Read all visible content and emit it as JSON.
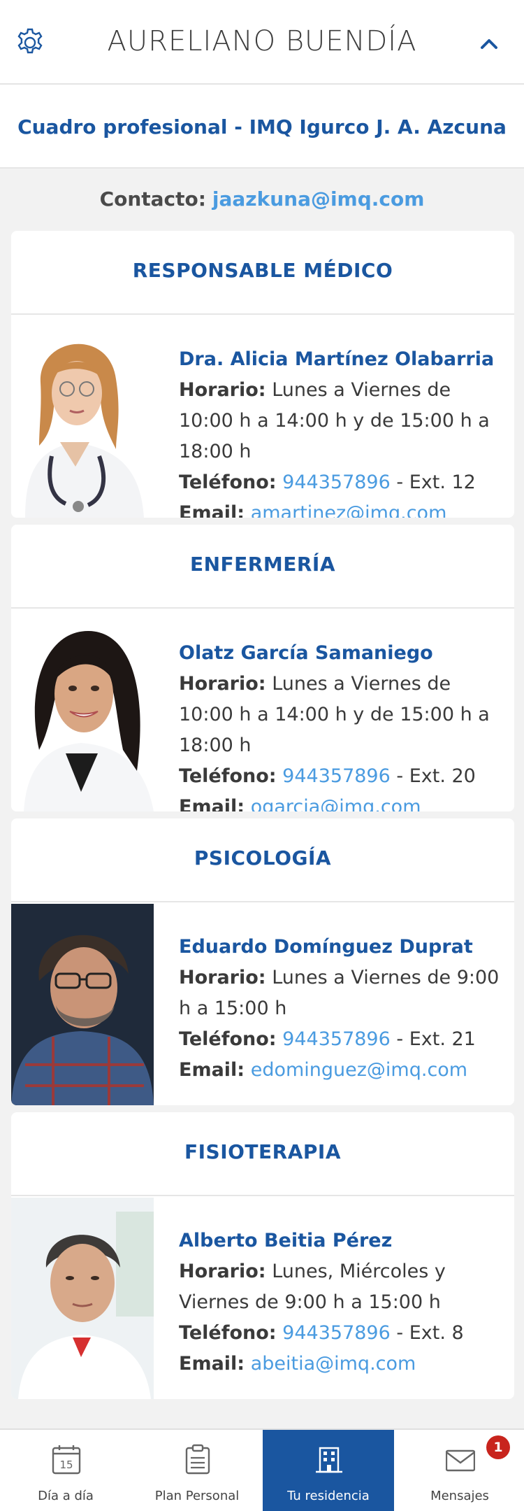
{
  "header": {
    "user_name": "AURELIANO BUENDÍA"
  },
  "subheader": {
    "title": "Cuadro profesional - IMQ Igurco J. A. Azcuna"
  },
  "contact": {
    "label": "Contacto:",
    "email": "jaazkuna@imq.com"
  },
  "labels": {
    "horario": "Horario:",
    "telefono": "Teléfono:",
    "email": "Email:"
  },
  "sections": [
    {
      "title": "RESPONSABLE MÉDICO",
      "name": "Dra. Alicia Martínez Olabarria",
      "horario": "Lunes a Viernes de 10:00 h a 14:00 h y de 15:00 h a 18:00 h",
      "phone": "944357896",
      "ext": "- Ext. 12",
      "email": "amartinez@imq.com"
    },
    {
      "title": "ENFERMERÍA",
      "name": "Olatz García Samaniego",
      "horario": "Lunes a Viernes de 10:00 h a 14:00 h y de 15:00 h a 18:00 h",
      "phone": "944357896",
      "ext": "- Ext. 20",
      "email": "ogarcia@imq.com"
    },
    {
      "title": "PSICOLOGÍA",
      "name": "Eduardo Domínguez Duprat",
      "horario": "Lunes a Viernes de 9:00 h a 15:00 h",
      "phone": "944357896",
      "ext": "- Ext. 21",
      "email": "edominguez@imq.com"
    },
    {
      "title": "FISIOTERAPIA",
      "name": "Alberto Beitia Pérez",
      "horario": "Lunes, Miércoles y Viernes de 9:00 h a 15:00 h",
      "phone": "944357896",
      "ext": "- Ext. 8",
      "email": "abeitia@imq.com"
    }
  ],
  "nav": {
    "items": [
      {
        "label": "Día a día",
        "icon": "calendar-icon",
        "day": "15"
      },
      {
        "label": "Plan Personal",
        "icon": "clipboard-icon"
      },
      {
        "label": "Tu residencia",
        "icon": "building-icon"
      },
      {
        "label": "Mensajes",
        "icon": "envelope-icon"
      }
    ],
    "messages_badge": "1"
  },
  "colors": {
    "brand": "#1a56a0",
    "link": "#4a9be0",
    "badge": "#c8241d"
  }
}
